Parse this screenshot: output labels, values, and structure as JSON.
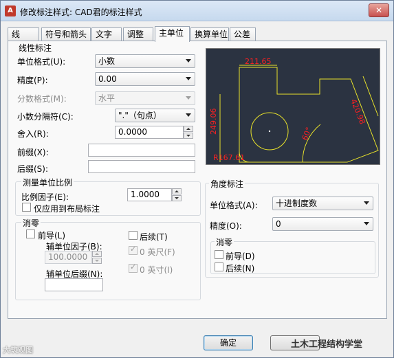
{
  "window": {
    "title": "修改标注样式: CAD君的标注样式",
    "close_glyph": "✕",
    "app_icon": "A"
  },
  "tabs": [
    "线",
    "符号和箭头",
    "文字",
    "调整",
    "主单位",
    "换算单位",
    "公差"
  ],
  "active_tab": "主单位",
  "linear": {
    "group_title": "线性标注",
    "unit_format": {
      "label": "单位格式(U):",
      "value": "小数"
    },
    "precision": {
      "label": "精度(P):",
      "value": "0.00"
    },
    "fraction_format": {
      "label": "分数格式(M):",
      "value": "水平"
    },
    "decimal_separator": {
      "label": "小数分隔符(C):",
      "value": "\".\"（句点）"
    },
    "round_off": {
      "label": "舍入(R):",
      "value": "0.0000"
    },
    "prefix": {
      "label": "前缀(X):",
      "value": ""
    },
    "suffix": {
      "label": "后缀(S):",
      "value": ""
    }
  },
  "scale": {
    "group_title": "测量单位比例",
    "scale_factor": {
      "label": "比例因子(E):",
      "value": "1.0000"
    },
    "layout_only": {
      "label": "仅应用到布局标注",
      "checked": false
    }
  },
  "zero_suppression": {
    "group_title": "消零",
    "leading": {
      "label": "前导(L)",
      "checked": false
    },
    "trailing": {
      "label": "后续(T)",
      "checked": false
    },
    "sub_unit_factor": {
      "label": "辅单位因子(B):",
      "value": "100.0000"
    },
    "sub_unit_suffix": {
      "label": "辅单位后缀(N):",
      "value": ""
    },
    "feet": {
      "label": "0 英尺(F)",
      "checked": true
    },
    "inches": {
      "label": "0 英寸(I)",
      "checked": true
    }
  },
  "preview": {
    "dim_top": "211.65",
    "dim_left": "249.06",
    "dim_right": "420.98",
    "dim_angle": "60°",
    "dim_radius": "R167.61",
    "line_color": "#e8e22a",
    "text_color": "#ff2020",
    "bg_color": "#2b3341"
  },
  "angular": {
    "group_title": "角度标注",
    "unit_format": {
      "label": "单位格式(A):",
      "value": "十进制度数"
    },
    "precision": {
      "label": "精度(O):",
      "value": "0"
    },
    "zero_group_title": "消零",
    "leading": {
      "label": "前导(D)",
      "checked": false
    },
    "trailing": {
      "label": "后续(N)",
      "checked": false
    }
  },
  "buttons": {
    "ok": "确定"
  },
  "watermark": {
    "left": "大筑观图",
    "right": "土木工程结构学堂"
  }
}
